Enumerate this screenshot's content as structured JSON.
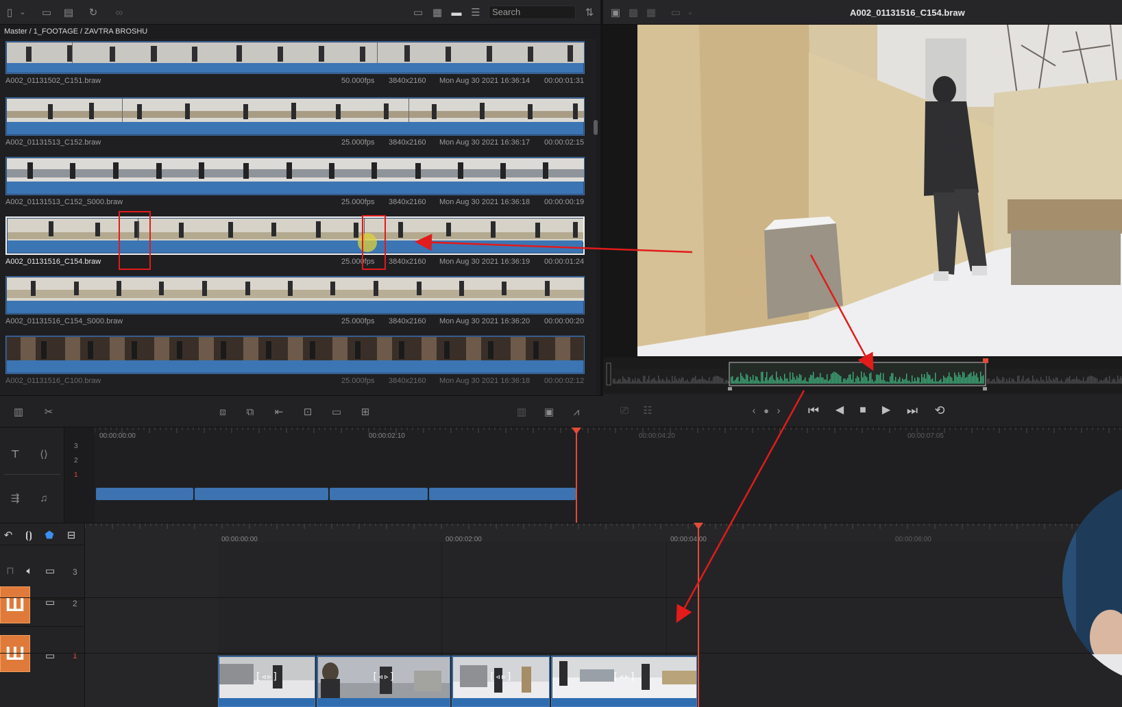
{
  "media_pool": {
    "search_placeholder": "Search",
    "breadcrumb": "Master / 1_FOOTAGE / ZAVTRA BROSHU",
    "clips": [
      {
        "name": "A002_01131502_C151.braw",
        "fps": "50.000fps",
        "resolution": "3840x2160",
        "date": "Mon Aug 30 2021 16:36:14",
        "duration": "00:00:01:31"
      },
      {
        "name": "A002_01131513_C152.braw",
        "fps": "25.000fps",
        "resolution": "3840x2160",
        "date": "Mon Aug 30 2021 16:36:17",
        "duration": "00:00:02:15"
      },
      {
        "name": "A002_01131513_C152_S000.braw",
        "fps": "25.000fps",
        "resolution": "3840x2160",
        "date": "Mon Aug 30 2021 16:36:18",
        "duration": "00:00:00:19"
      },
      {
        "name": "A002_01131516_C154.braw",
        "fps": "25.000fps",
        "resolution": "3840x2160",
        "date": "Mon Aug 30 2021 16:36:19",
        "duration": "00:00:01:24"
      },
      {
        "name": "A002_01131516_C154_S000.braw",
        "fps": "25.000fps",
        "resolution": "3840x2160",
        "date": "Mon Aug 30 2021 16:36:20",
        "duration": "00:00:00:20"
      },
      {
        "name": "A002_01131516_C100.braw",
        "fps": "25.000fps",
        "resolution": "3840x2160",
        "date": "Mon Aug 30 2021 16:36:18",
        "duration": "00:00:02:12"
      }
    ]
  },
  "viewer": {
    "title": "A002_01131516_C154.braw"
  },
  "upper_timeline": {
    "timecodes": [
      "00:00:00:00",
      "00:00:02:10",
      "00:00:04:20",
      "00:00:07:05"
    ],
    "track_numbers": [
      "3",
      "2",
      "1"
    ]
  },
  "lower_timeline": {
    "timecodes": [
      "00:00:00:00",
      "00:00:02:00",
      "00:00:04:00",
      "00:00:06:00"
    ],
    "track_numbers": [
      "3",
      "2",
      "1"
    ],
    "badge_glyph": "Ш",
    "clip_tag": "[◃▹]"
  },
  "colors": {
    "accent_blue": "#3c75b3",
    "playhead": "#e34b3a",
    "annotation_red": "#e21b1b",
    "badge_orange": "#e07a3b",
    "waveform_green": "#3fae7c"
  }
}
